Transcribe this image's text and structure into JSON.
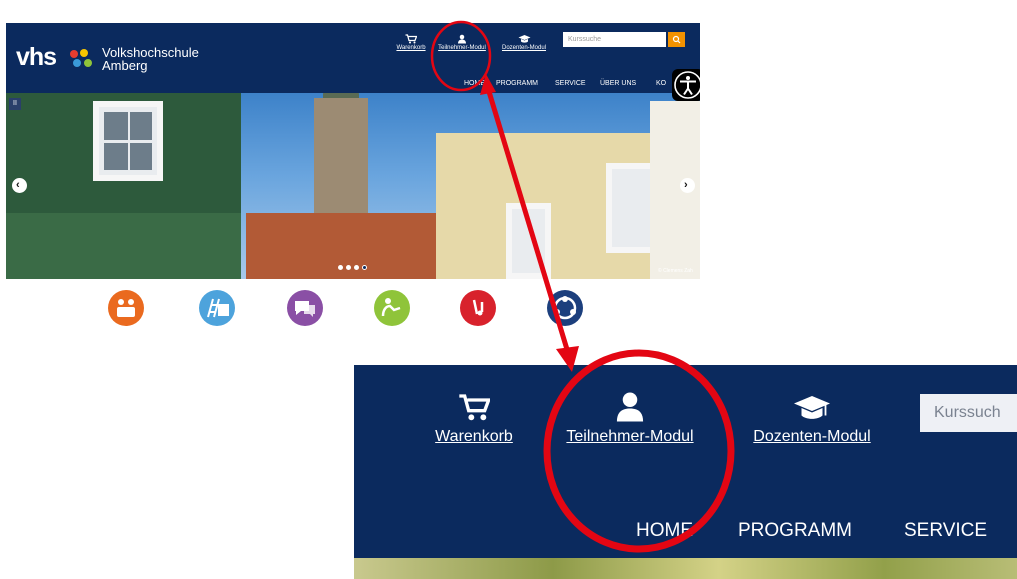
{
  "small_screenshot": {
    "logo_text": "vhs",
    "org_name_line1": "Volkshochschule",
    "org_name_line2": "Amberg",
    "tools": {
      "cart": "Warenkorb",
      "participant": "Teilnehmer-Modul",
      "lecturer": "Dozenten-Modul"
    },
    "search_placeholder": "Kurssuche",
    "nav": [
      "HOME",
      "PROGRAMM",
      "SERVICE",
      "ÜBER UNS",
      "KO"
    ],
    "pause_symbol": "II",
    "slider_prev": "‹",
    "slider_next": "›",
    "photo_credit": "© Clemens Zah",
    "slider_active_index": 3,
    "category_colors": [
      "#ea6a1f",
      "#4da3dc",
      "#8a4fa5",
      "#8fc43a",
      "#d8222c",
      "#1c3f7d"
    ]
  },
  "zoomed_screenshot": {
    "tools": {
      "cart": "Warenkorb",
      "participant": "Teilnehmer-Modul",
      "lecturer": "Dozenten-Modul"
    },
    "search_placeholder": "Kurssuch",
    "nav": [
      "HOME",
      "PROGRAMM",
      "SERVICE"
    ]
  },
  "colors": {
    "header_bg": "#0b2a5e",
    "accent_orange": "#f39200",
    "highlight_red": "#e30613"
  },
  "icons": {
    "cart": "shopping-cart-icon",
    "participant": "user-icon",
    "lecturer": "graduation-cap-icon",
    "search": "search-icon",
    "accessibility": "accessibility-icon"
  }
}
